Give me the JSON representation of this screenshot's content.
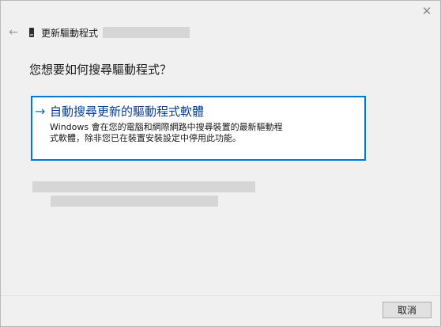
{
  "window": {
    "close_glyph": "✕"
  },
  "header": {
    "back_glyph": "←",
    "title": "更新驅動程式"
  },
  "main": {
    "question": "您想要如何搜尋驅動程式？",
    "option": {
      "arrow_glyph": "→",
      "title": "自動搜尋更新的驅動程式軟體",
      "description": "Windows 會在您的電腦和網際網路中搜尋裝置的最新驅動程式軟體，除非您已在裝置安裝設定中停用此功能。"
    }
  },
  "footer": {
    "cancel_label": "取消"
  },
  "colors": {
    "accent": "#0078d7",
    "option_title": "#0a3d91",
    "background": "#f0f0f0"
  },
  "icons": {
    "back": "back-arrow-icon",
    "device": "device-icon",
    "close": "close-icon",
    "option": "arrow-right-icon"
  }
}
